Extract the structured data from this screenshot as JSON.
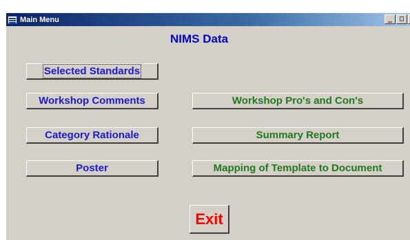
{
  "window": {
    "title": "Main Menu",
    "controls": {
      "minimize": "_",
      "maximize": "□",
      "close": "×"
    }
  },
  "form": {
    "heading": "NIMS Data",
    "buttons_left": [
      "Selected Standards",
      "Workshop Comments",
      "Category Rationale",
      "Poster"
    ],
    "buttons_right": [
      "Workshop Pro's and Con's",
      "Summary Report",
      "Mapping of Template to Document"
    ],
    "exit_label": "Exit"
  },
  "colors": {
    "left_text": "#1a1ad6",
    "right_text": "#1f7a1f",
    "exit_text": "#ff0000",
    "face": "#d4d0c8"
  }
}
